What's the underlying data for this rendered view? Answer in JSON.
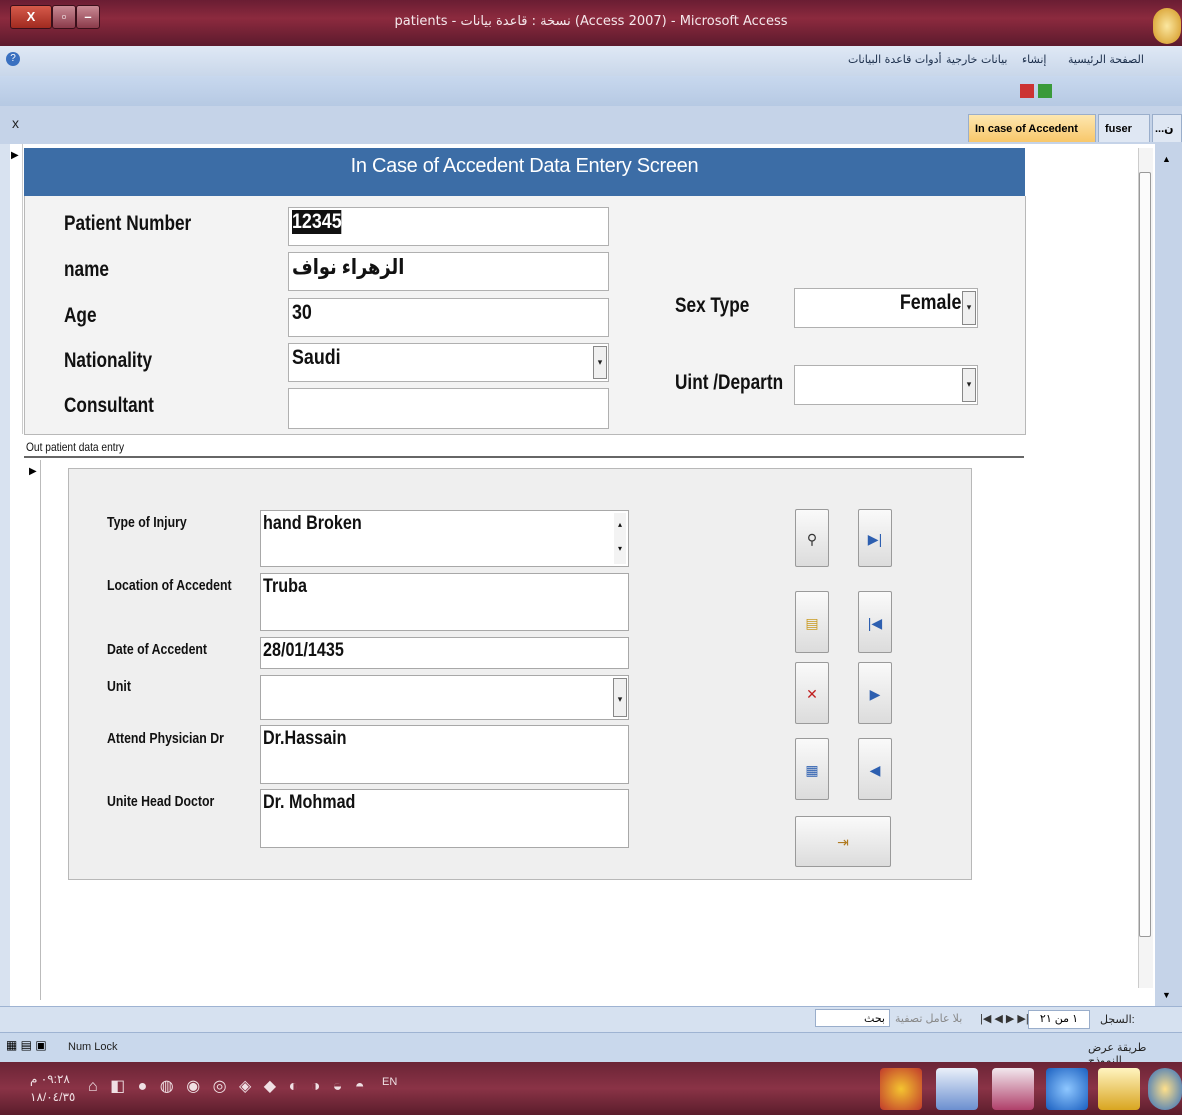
{
  "window": {
    "title": "patients - نسخة : قاعدة بيانات (Access 2007) - Microsoft Access"
  },
  "ribbon": {
    "tabs": [
      "الصفحة الرئيسية",
      "إنشاء",
      "بيانات خارجية",
      "أدوات قاعدة البيانات"
    ]
  },
  "doc_tabs": [
    {
      "label": "In case of Accedent",
      "active": true
    },
    {
      "label": "fuser",
      "active": false
    },
    {
      "label": "...ن",
      "active": false
    }
  ],
  "form": {
    "header": "In Case of Accedent Data Entery Screen",
    "labels": {
      "patient_number": "Patient Number",
      "name": "name",
      "age": "Age",
      "nationality": "Nationality",
      "consultant": "Consultant",
      "sex_type": "Sex Type",
      "unit_department": "Uint /Departn"
    },
    "values": {
      "patient_number": "12345",
      "name": "الزهراء نواف",
      "age": "30",
      "nationality": "Saudi",
      "consultant": "",
      "sex_type": "Female",
      "unit_department": ""
    }
  },
  "subform": {
    "label": "Out patient  data entry",
    "labels": {
      "type_of_injury": "Type of Injury",
      "location": "Location of Accedent",
      "date": "Date of Accedent",
      "unit": "Unit",
      "attend_physician": "Attend Physician Dr",
      "head_doctor": "Unite Head Doctor"
    },
    "values": {
      "type_of_injury": "hand Broken",
      "location": "Truba",
      "date": "28/01/1435",
      "unit": "",
      "attend_physician": "Dr.Hassain",
      "head_doctor": "Dr. Mohmad"
    }
  },
  "record_nav": {
    "label": "السجل:",
    "position": "١ من ٢١",
    "filter": "بلا عامل تصفية",
    "search": "بحث"
  },
  "status": {
    "left": "Num Lock",
    "right": "طريقة عرض النموذج"
  },
  "taskbar": {
    "time": "٠٩:٢٨ م",
    "date": "١٨/٠٤/٣٥",
    "lang": "EN"
  },
  "colors": {
    "header_bg": "#3c6da6",
    "active_tab": "#f8c76a",
    "taskbar": "#6b2436"
  },
  "icons": [
    "find-icon",
    "last-record-icon",
    "new-record-icon",
    "first-record-icon",
    "delete-record-icon",
    "next-record-icon",
    "save-record-icon",
    "previous-record-icon",
    "exit-icon"
  ]
}
